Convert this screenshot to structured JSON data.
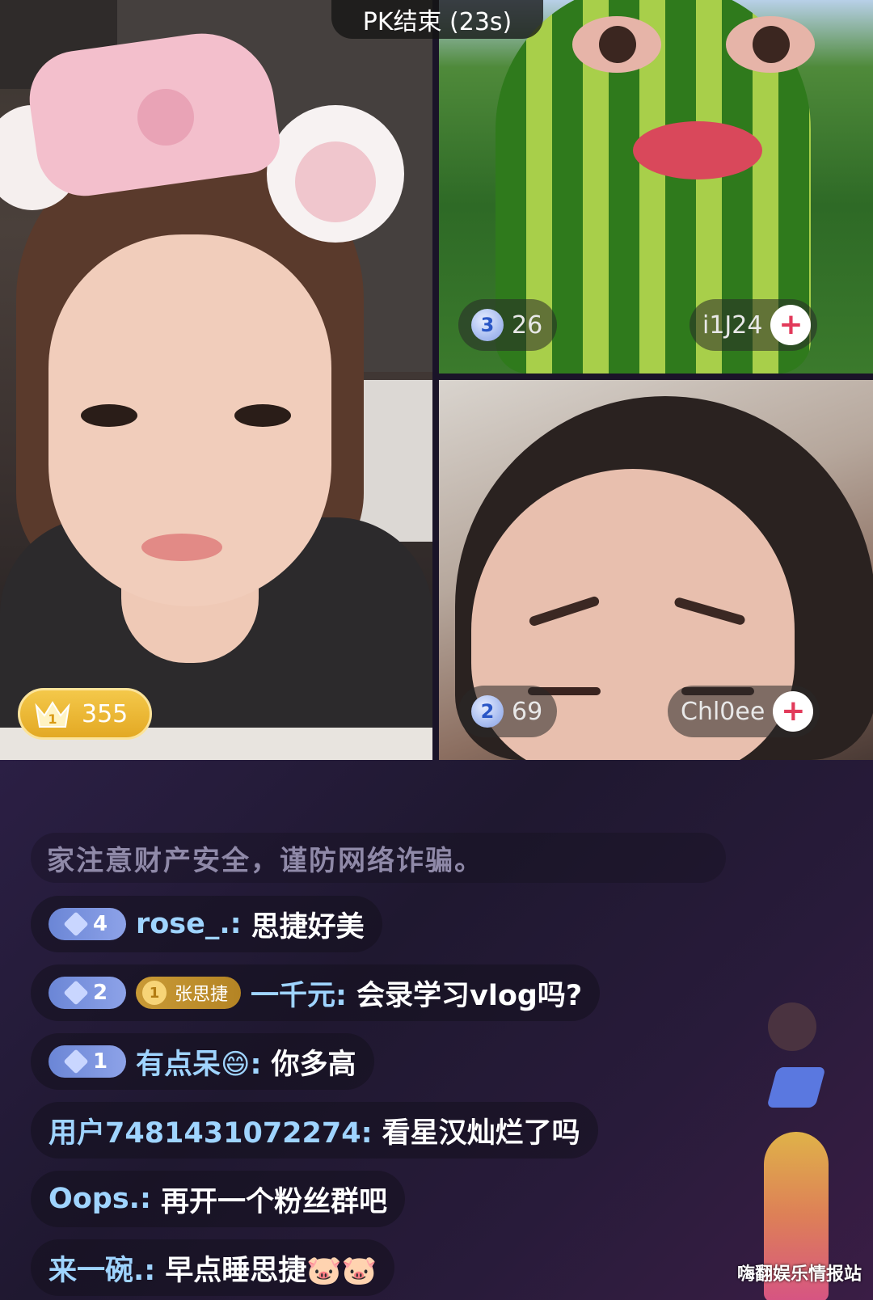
{
  "pk_status": {
    "label": "PK结束 (23s)"
  },
  "tiles": {
    "main": {
      "score": "355"
    },
    "top_right": {
      "rank": "3",
      "score": "26",
      "username": "i1J24"
    },
    "bottom_right": {
      "rank": "2",
      "score": "69",
      "username": "Chl0ee"
    }
  },
  "chat": {
    "system_notice": "家注意财产安全，谨防网络诈骗。",
    "messages": [
      {
        "level": "4",
        "user": "rose_.:",
        "text": "思捷好美"
      },
      {
        "level": "2",
        "fan_badge": "张思捷",
        "fan_level": "1",
        "user": "一千元:",
        "text": "会录学习vlog吗?"
      },
      {
        "level": "1",
        "user": "有点呆😄:",
        "text": "你多高"
      },
      {
        "user": "用户7481431072274:",
        "text": "看星汉灿烂了吗"
      },
      {
        "user": "Oops.:",
        "text": "再开一个粉丝群吧"
      },
      {
        "user": "来一碗.:",
        "text": "早点睡思捷🐷🐷"
      }
    ]
  },
  "watermark": "嗨翻娱乐情报站"
}
